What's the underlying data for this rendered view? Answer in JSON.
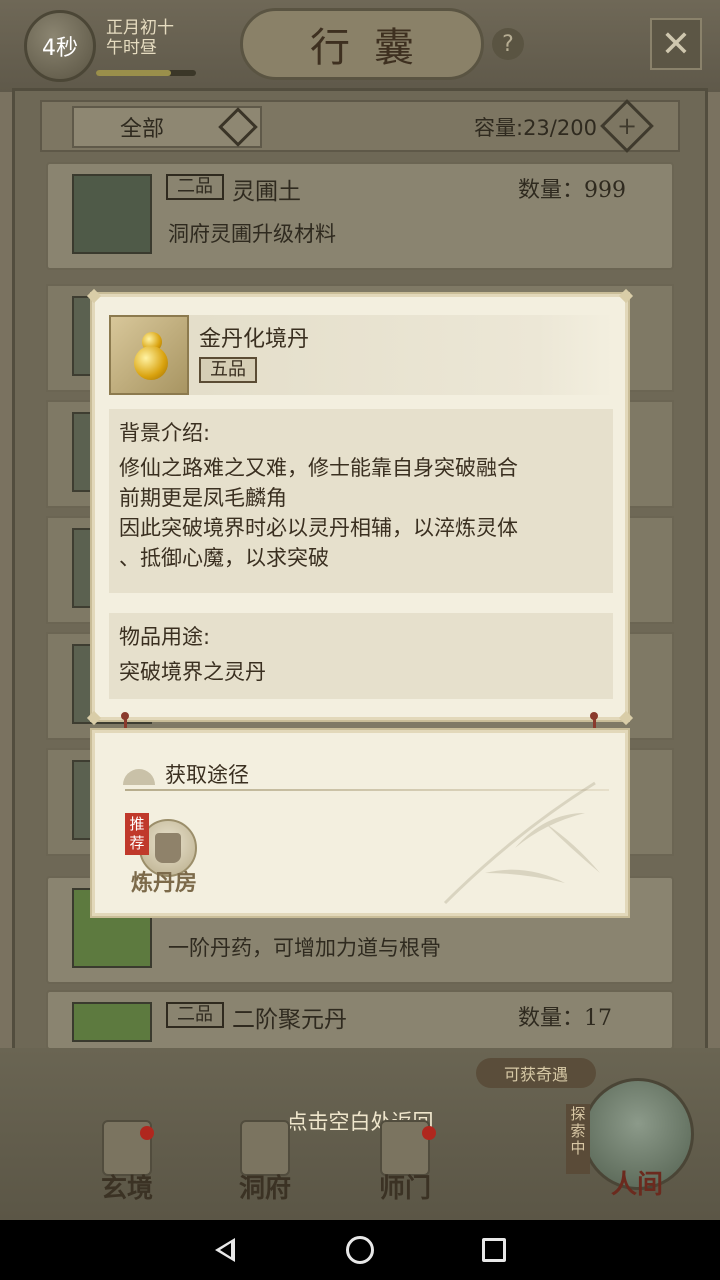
{
  "top": {
    "timer": "4秒",
    "date_line1": "正月初十",
    "date_line2": "午时昼",
    "title": "行囊",
    "help_icon": "question-icon",
    "close_icon": "close-icon"
  },
  "bag": {
    "filter": "全部",
    "capacity": "容量:23/200",
    "items": [
      {
        "grade": "二品",
        "name": "灵圃土",
        "qty": "数量：999",
        "desc": "洞府灵圃升级材料"
      },
      {
        "desc": "一阶丹药，可增加力道与根骨"
      },
      {
        "grade": "二品",
        "name": "二阶聚元丹",
        "qty": "数量：17"
      }
    ]
  },
  "popup": {
    "name": "金丹化境丹",
    "grade": "五品",
    "background_title": "背景介绍:",
    "background_lines": [
      "修仙之路难之又难，修士能靠自身突破融合",
      "前期更是凤毛麟角",
      "因此突破境界时必以灵丹相辅，以淬炼灵体",
      "、抵御心魔，以求突破"
    ],
    "usage_title": "物品用途:",
    "usage_text": "突破境界之灵丹"
  },
  "source": {
    "title": "获取途径",
    "recommend": "推荐",
    "place": "炼丹房"
  },
  "bottom": {
    "opportunity": "可获奇遇",
    "return_hint": "点击空白处返回",
    "nav": [
      "玄境",
      "洞府",
      "师门",
      "人间"
    ],
    "explore_badge": "探索中"
  }
}
